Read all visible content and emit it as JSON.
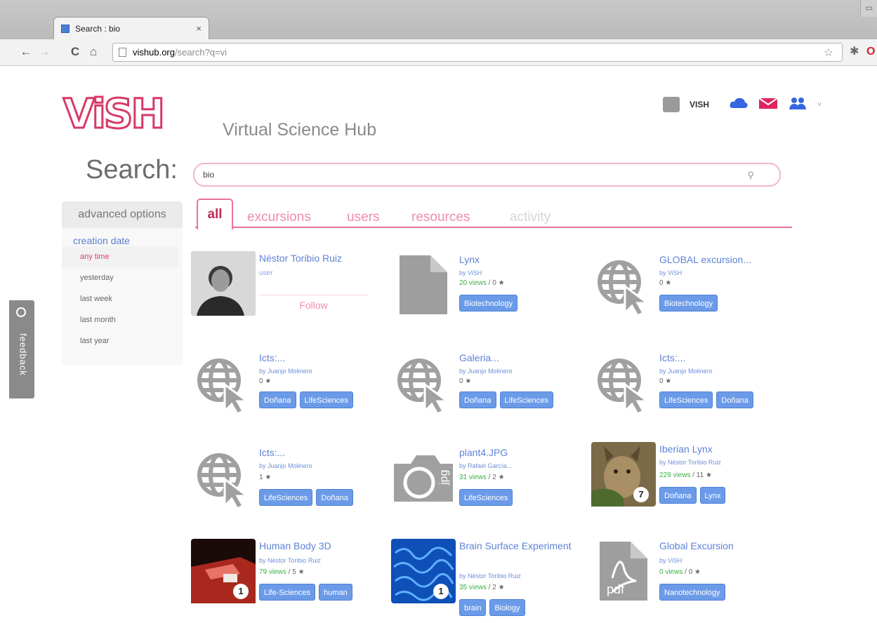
{
  "browser": {
    "tab_title": "Search : bio",
    "tab_close": "×",
    "url_domain": "vishub.org",
    "url_path": "/search?q=vi",
    "back": "←",
    "forward": "→",
    "reload": "C",
    "home": "⌂",
    "star": "☆"
  },
  "header": {
    "logo_text": "ViSH",
    "logo_subtitle": "Virtual Science Hub",
    "user_name": "VISH"
  },
  "search": {
    "label": "Search:",
    "query": "bio"
  },
  "sidebar": {
    "advanced_label": "advanced options",
    "creation_date_label": "creation date",
    "options": [
      "any time",
      "yesterday",
      "last week",
      "last month",
      "last year"
    ]
  },
  "feedback": {
    "label": "feedback"
  },
  "tabs": [
    "all",
    "excursions",
    "users",
    "resources",
    "activity"
  ],
  "results": [
    {
      "title": "Néstor Toribio Ruiz",
      "role": "user",
      "follow": "Follow"
    },
    {
      "title": "Lynx",
      "by": "by ViSH",
      "views": "20 views",
      "likes": " / 0 ★",
      "tags": [
        "Biotechnology"
      ]
    },
    {
      "title": "GLOBAL excursion...",
      "by": "by ViSH",
      "likes": "0 ★",
      "tags": [
        "Biotechnology"
      ]
    },
    {
      "title": "Icts:...",
      "by": "by Juanjo Molinero",
      "likes": "0 ★",
      "tags": [
        "Doñana",
        "LifeSciences"
      ]
    },
    {
      "title": "Galeria...",
      "by": "by Juanjo Molinero",
      "likes": "0 ★",
      "tags": [
        "Doñana",
        "LifeSciences"
      ]
    },
    {
      "title": "Icts:...",
      "by": "by Juanjo Molinero",
      "likes": "0 ★",
      "tags": [
        "LifeSciences",
        "Doñana"
      ]
    },
    {
      "title": "Icts:...",
      "by": "by Juanjo Molinero",
      "likes": "1 ★",
      "tags": [
        "LifeSciences",
        "Doñana"
      ]
    },
    {
      "title": "plant4.JPG",
      "by": "by Rafael García...",
      "views": "31 views",
      "likes": " / 2 ★",
      "tags": [
        "LifeSciences"
      ]
    },
    {
      "title": "Iberian Lynx",
      "by": "by Néstor Toribio Ruiz",
      "views": "229 views",
      "likes": " / 11 ★",
      "tags": [
        "Doñana",
        "Lynx"
      ],
      "badge": "7"
    },
    {
      "title": "Human Body 3D",
      "by": "by Néstor Toribio Ruiz",
      "views": "79 views",
      "likes": " / 5 ★",
      "tags": [
        "Life-Sciences",
        "human"
      ],
      "badge": "1"
    },
    {
      "title": "Brain Surface Experiment",
      "by": "by Néstor Toribio Ruiz",
      "views": "35 views",
      "likes": " / 2 ★",
      "tags": [
        "brain",
        "Biology"
      ],
      "badge": "1"
    },
    {
      "title": "Global Excursion",
      "by": "by ViSH",
      "views": "0 views",
      "likes": " / 0 ★",
      "tags": [
        "Nanotechnology"
      ],
      "pdf_label": "pdf"
    }
  ],
  "colors": {
    "accent": "#d83868",
    "link": "#5e82d6",
    "tag": "#6b9be8"
  }
}
